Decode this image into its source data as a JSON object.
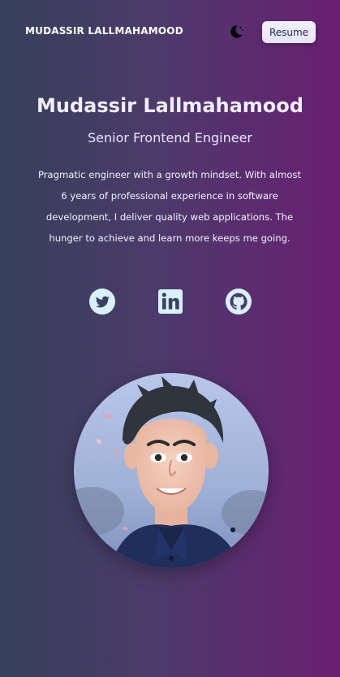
{
  "header": {
    "brand": "MUDASSIR LALLMAHAMOOD",
    "theme_toggle_icon": "moon-icon",
    "resume_label": "Resume"
  },
  "hero": {
    "name": "Mudassir Lallmahamood",
    "role": "Senior Frontend Engineer",
    "bio": "Pragmatic engineer with a growth mindset. With almost 6 years of professional experience in software development, I deliver quality web applications. The hunger to achieve and learn more keeps me going."
  },
  "socials": [
    {
      "icon": "twitter-icon"
    },
    {
      "icon": "linkedin-icon"
    },
    {
      "icon": "github-icon"
    }
  ],
  "colors": {
    "background_start": "#36405a",
    "background_end": "#6a1f72",
    "icon_fill": "#d9f1ff",
    "button_bg": "#ece9ff"
  }
}
